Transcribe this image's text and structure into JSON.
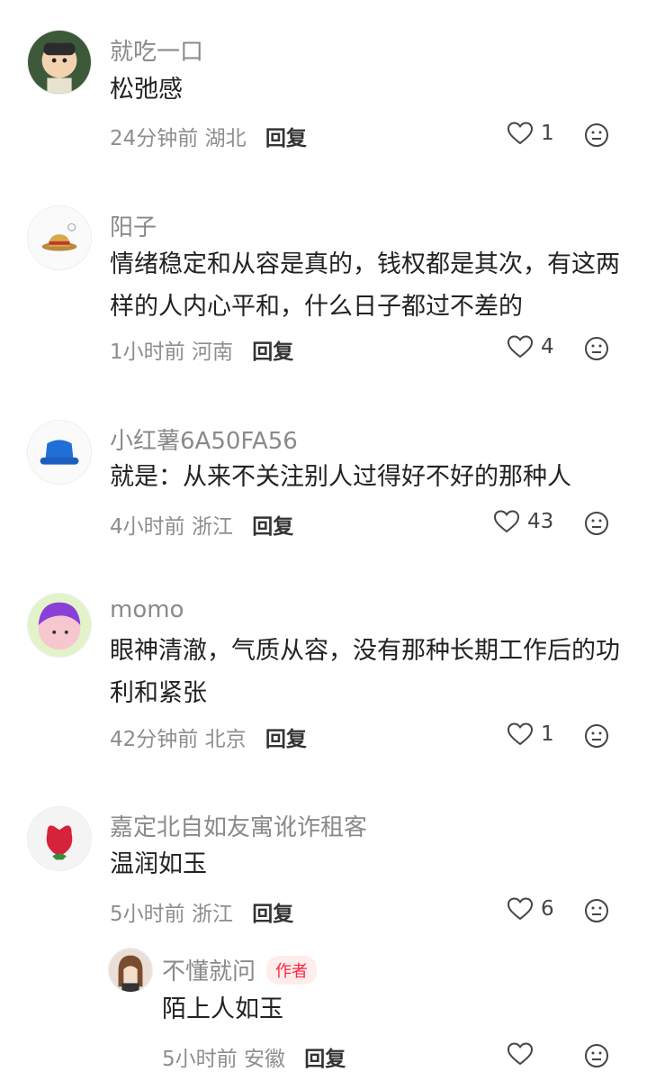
{
  "comments": [
    {
      "user": "就吃一口",
      "text": "松弛感",
      "time": "24分钟前",
      "location": "湖北",
      "reply_label": "回复",
      "likes": "1"
    },
    {
      "user": "阳子",
      "text": "情绪稳定和从容是真的，钱权都是其次，有这两样的人内心平和，什么日子都过不差的",
      "time": "1小时前",
      "location": "河南",
      "reply_label": "回复",
      "likes": "4"
    },
    {
      "user": "小红薯6A50FA56",
      "text": "就是：从来不关注别人过得好不好的那种人",
      "time": "4小时前",
      "location": "浙江",
      "reply_label": "回复",
      "likes": "43"
    },
    {
      "user": "momo",
      "text": "眼神清澈，气质从容，没有那种长期工作后的功利和紧张",
      "time": "42分钟前",
      "location": "北京",
      "reply_label": "回复",
      "likes": "1"
    },
    {
      "user": "嘉定北自如友寓讹诈租客",
      "text": "温润如玉",
      "time": "5小时前",
      "location": "浙江",
      "reply_label": "回复",
      "likes": "6"
    }
  ],
  "reply": {
    "user": "不懂就问",
    "badge": "作者",
    "text": "陌上人如玉",
    "time": "5小时前",
    "location": "安徽",
    "reply_label": "回复",
    "likes": ""
  },
  "colors": {
    "accent": "#ff2442",
    "muted": "#8e8e8e"
  },
  "icons": {
    "like": "heart-outline-icon",
    "more": "emoji-face-icon"
  }
}
